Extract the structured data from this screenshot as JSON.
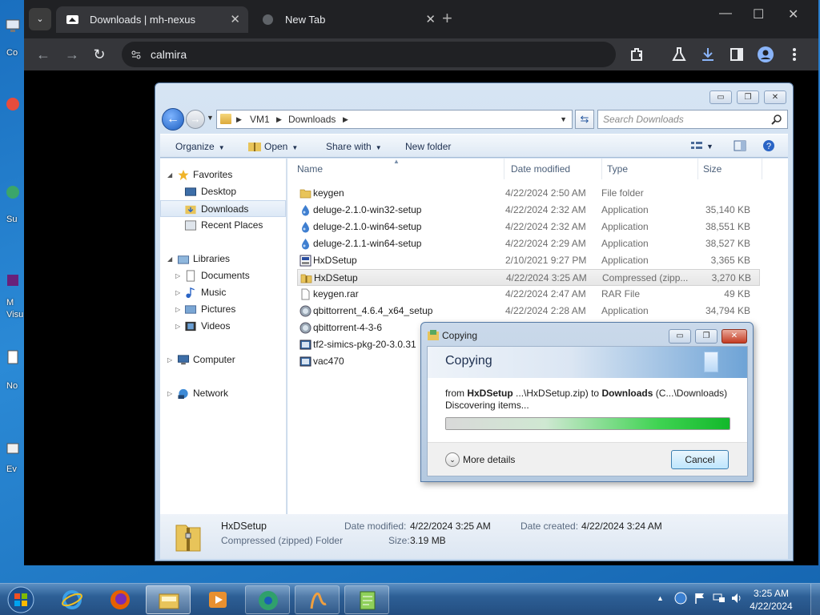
{
  "desktop": {
    "left_labels": [
      "Co",
      "Su",
      "M",
      "Visu",
      "No",
      "Ev"
    ]
  },
  "browser": {
    "tabs": [
      {
        "title": "Downloads | mh-nexus",
        "active": true
      },
      {
        "title": "New Tab",
        "active": false
      }
    ],
    "new_tab": "+",
    "tab_close": "✕",
    "window_controls": {
      "minimize": "—",
      "maximize": "☐",
      "close": "✕"
    },
    "address": "calmira",
    "toolbar_icons": [
      "back-icon",
      "forward-icon",
      "reload-icon",
      "site-settings-icon",
      "extensions-icon",
      "labs-icon",
      "download-icon",
      "sidepanel-icon",
      "profile-icon",
      "menu-icon"
    ]
  },
  "explorer": {
    "window_controls": {
      "minimize": "▭",
      "maximize": "❐",
      "close": "✕"
    },
    "breadcrumb": [
      "VM1",
      "Downloads"
    ],
    "search_placeholder": "Search Downloads",
    "commands": {
      "organize": "Organize",
      "open": "Open",
      "share_with": "Share with",
      "new_folder": "New folder"
    },
    "nav": {
      "favorites": "Favorites",
      "desktop": "Desktop",
      "downloads": "Downloads",
      "recent_places": "Recent Places",
      "libraries": "Libraries",
      "documents": "Documents",
      "music": "Music",
      "pictures": "Pictures",
      "videos": "Videos",
      "computer": "Computer",
      "network": "Network"
    },
    "columns": {
      "name": "Name",
      "date": "Date modified",
      "type": "Type",
      "size": "Size"
    },
    "files": [
      {
        "name": "keygen",
        "date": "4/22/2024 2:50 AM",
        "type": "File folder",
        "size": "",
        "icon": "folder-icon"
      },
      {
        "name": "deluge-2.1.0-win32-setup",
        "date": "4/22/2024 2:32 AM",
        "type": "Application",
        "size": "35,140 KB",
        "icon": "deluge-icon"
      },
      {
        "name": "deluge-2.1.0-win64-setup",
        "date": "4/22/2024 2:32 AM",
        "type": "Application",
        "size": "38,551 KB",
        "icon": "deluge-icon"
      },
      {
        "name": "deluge-2.1.1-win64-setup",
        "date": "4/22/2024 2:29 AM",
        "type": "Application",
        "size": "38,527 KB",
        "icon": "deluge-icon"
      },
      {
        "name": "HxDSetup",
        "date": "2/10/2021 9:27 PM",
        "type": "Application",
        "size": "3,365 KB",
        "icon": "hxd-setup-icon"
      },
      {
        "name": "HxDSetup",
        "date": "4/22/2024 3:25 AM",
        "type": "Compressed (zipp...",
        "size": "3,270 KB",
        "icon": "zip-folder-icon"
      },
      {
        "name": "keygen.rar",
        "date": "4/22/2024 2:47 AM",
        "type": "RAR File",
        "size": "49 KB",
        "icon": "file-icon"
      },
      {
        "name": "qbittorrent_4.6.4_x64_setup",
        "date": "4/22/2024 2:28 AM",
        "type": "Application",
        "size": "34,794 KB",
        "icon": "qbittorrent-icon"
      },
      {
        "name": "qbittorrent-4-3-6",
        "date": "",
        "type": "",
        "size": "",
        "icon": "qbittorrent-icon"
      },
      {
        "name": "tf2-simics-pkg-20-3.0.31",
        "date": "",
        "type": "",
        "size": "",
        "icon": "installer-icon"
      },
      {
        "name": "vac470",
        "date": "",
        "type": "",
        "size": "",
        "icon": "installer-icon"
      }
    ],
    "details": {
      "name": "HxDSetup",
      "kind": "Compressed (zipped) Folder",
      "date_modified_label": "Date modified:",
      "date_modified": "4/22/2024 3:25 AM",
      "date_created_label": "Date created:",
      "date_created": "4/22/2024 3:24 AM",
      "size_label": "Size:",
      "size": "3.19 MB"
    }
  },
  "copy_dialog": {
    "window_title": "Copying",
    "heading": "Copying",
    "from_word": "from",
    "source_name": "HxDSetup",
    "source_path": "...\\HxDSetup.zip)",
    "to_word": "to",
    "dest_name": "Downloads",
    "dest_path": "(C...\\Downloads)",
    "status": "Discovering items...",
    "progress": 1.0,
    "more_details": "More details",
    "cancel": "Cancel"
  },
  "taskbar": {
    "apps": [
      "start-orb-icon",
      "internet-explorer-icon",
      "firefox-icon",
      "file-explorer-icon",
      "media-player-icon",
      "chrome-icon",
      "app-icon",
      "notepad-icon"
    ],
    "tray_arrow": "▲",
    "time": "3:25 AM",
    "date": "4/22/2024"
  },
  "colors": {
    "chrome_bg": "#202124",
    "chrome_toolbar": "#35363a",
    "download_accent": "#8ab4f8",
    "progress_green": "#19c332",
    "cancel_border": "#3c7fb1"
  }
}
